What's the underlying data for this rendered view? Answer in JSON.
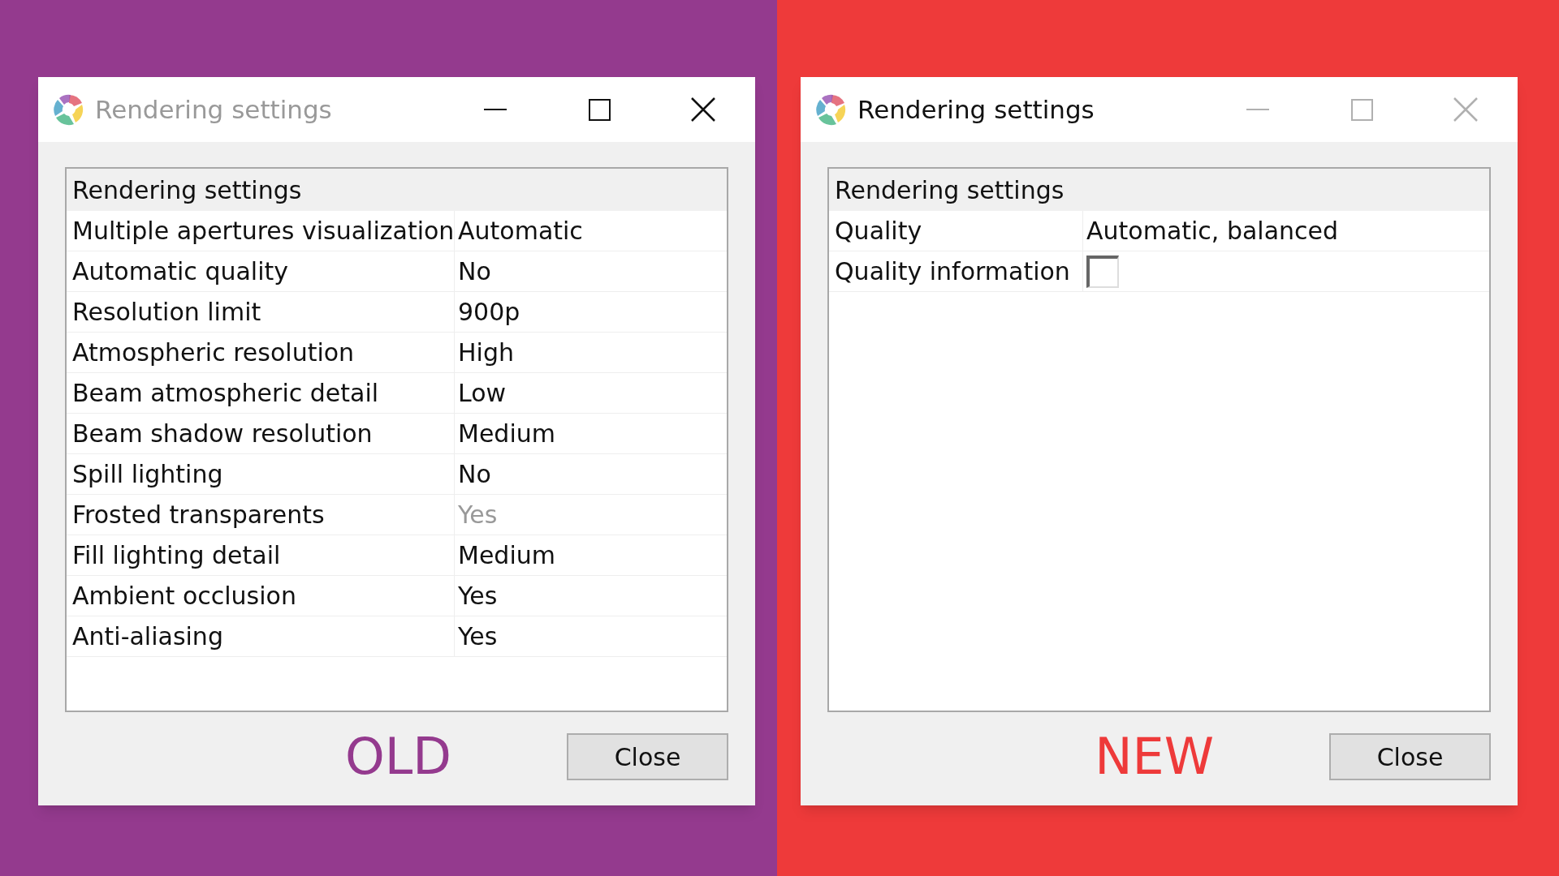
{
  "panels": [
    {
      "color": "#943a8e",
      "window": {
        "title": "Rendering settings",
        "active": false
      },
      "table": {
        "header": "Rendering settings",
        "rows": [
          {
            "kind": "text",
            "label": "Multiple apertures visualization",
            "value": "Automatic",
            "disabled": false
          },
          {
            "kind": "text",
            "label": "Automatic quality",
            "value": "No",
            "disabled": false
          },
          {
            "kind": "text",
            "label": "Resolution limit",
            "value": "900p",
            "disabled": false
          },
          {
            "kind": "text",
            "label": "Atmospheric resolution",
            "value": "High",
            "disabled": false
          },
          {
            "kind": "text",
            "label": "Beam atmospheric detail",
            "value": "Low",
            "disabled": false
          },
          {
            "kind": "text",
            "label": "Beam shadow resolution",
            "value": "Medium",
            "disabled": false
          },
          {
            "kind": "text",
            "label": "Spill lighting",
            "value": "No",
            "disabled": false
          },
          {
            "kind": "text",
            "label": "Frosted transparents",
            "value": "Yes",
            "disabled": true
          },
          {
            "kind": "text",
            "label": "Fill lighting detail",
            "value": "Medium",
            "disabled": false
          },
          {
            "kind": "text",
            "label": "Ambient occlusion",
            "value": "Yes",
            "disabled": false
          },
          {
            "kind": "text",
            "label": "Anti-aliasing",
            "value": "Yes",
            "disabled": false
          }
        ]
      },
      "caption": "OLD",
      "button": "Close"
    },
    {
      "color": "#ee3a3a",
      "window": {
        "title": "Rendering settings",
        "active": true
      },
      "table": {
        "header": "Rendering settings",
        "rows": [
          {
            "kind": "text",
            "label": "Quality",
            "value": "Automatic, balanced",
            "disabled": false
          },
          {
            "kind": "checkbox",
            "label": "Quality information",
            "checked": false
          }
        ]
      },
      "caption": "NEW",
      "button": "Close"
    }
  ]
}
